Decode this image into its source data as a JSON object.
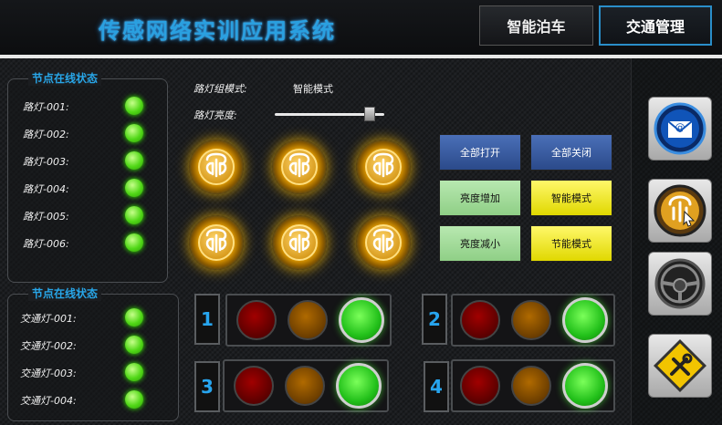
{
  "header": {
    "title": "传感网络实训应用系统",
    "tabs": [
      {
        "label": "智能泊车"
      },
      {
        "label": "交通管理"
      }
    ]
  },
  "street_light_panel": {
    "title": "节点在线状态",
    "nodes": [
      {
        "label": "路灯-001:",
        "status_color": "#4fd61a"
      },
      {
        "label": "路灯-002:",
        "status_color": "#4fd61a"
      },
      {
        "label": "路灯-003:",
        "status_color": "#4fd61a"
      },
      {
        "label": "路灯-004:",
        "status_color": "#4fd61a"
      },
      {
        "label": "路灯-005:",
        "status_color": "#4fd61a"
      },
      {
        "label": "路灯-006:",
        "status_color": "#4fd61a"
      }
    ]
  },
  "traffic_panel": {
    "title": "节点在线状态",
    "nodes": [
      {
        "label": "交通灯-001:",
        "status_color": "#4fd61a"
      },
      {
        "label": "交通灯-002:",
        "status_color": "#4fd61a"
      },
      {
        "label": "交通灯-003:",
        "status_color": "#4fd61a"
      },
      {
        "label": "交通灯-004:",
        "status_color": "#4fd61a"
      }
    ]
  },
  "controls": {
    "mode_label": "路灯组模式:",
    "mode_value": "智能模式",
    "brightness_label": "路灯亮度:",
    "brightness_fraction": 0.87
  },
  "lamps": [
    {
      "icon": "street-lamp-icon",
      "state": "on"
    },
    {
      "icon": "street-lamp-icon",
      "state": "on"
    },
    {
      "icon": "street-lamp-icon",
      "state": "on"
    },
    {
      "icon": "street-lamp-icon",
      "state": "on"
    },
    {
      "icon": "street-lamp-icon",
      "state": "on"
    },
    {
      "icon": "street-lamp-icon",
      "state": "on"
    }
  ],
  "buttons": {
    "all_on": "全部打开",
    "all_off": "全部关闭",
    "bright_up": "亮度增加",
    "smart_mode": "智能模式",
    "bright_down": "亮度减小",
    "eco_mode": "节能模式"
  },
  "traffic_lights": [
    {
      "number": "1",
      "active": "green"
    },
    {
      "number": "2",
      "active": "green"
    },
    {
      "number": "3",
      "active": "green"
    },
    {
      "number": "4",
      "active": "green"
    }
  ],
  "side_nav": [
    {
      "icon": "mail-icon"
    },
    {
      "icon": "street-lamp-icon"
    },
    {
      "icon": "steering-wheel-icon"
    },
    {
      "icon": "tools-icon"
    }
  ],
  "colors": {
    "accent_blue": "#28a6e8",
    "online_green": "#4fd61a",
    "lamp_gold": "#f4b80a"
  }
}
